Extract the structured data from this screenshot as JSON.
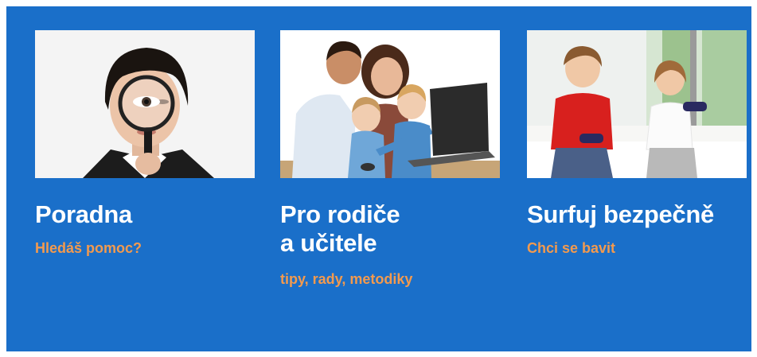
{
  "cards": [
    {
      "title": "Poradna",
      "subtitle": "Hledáš pomoc?",
      "photo": "woman-with-magnifying-glass"
    },
    {
      "title_line1": "Pro rodiče",
      "title_line2": "a učitele",
      "subtitle": "tipy, rady, metodiky",
      "photo": "family-with-laptop"
    },
    {
      "title": "Surfuj bezpečně",
      "subtitle": "Chci se bavit",
      "photo": "kids-playing-video-games"
    }
  ],
  "colors": {
    "panel": "#1a6fc9",
    "title": "#ffffff",
    "subtitle": "#f39a4e"
  }
}
